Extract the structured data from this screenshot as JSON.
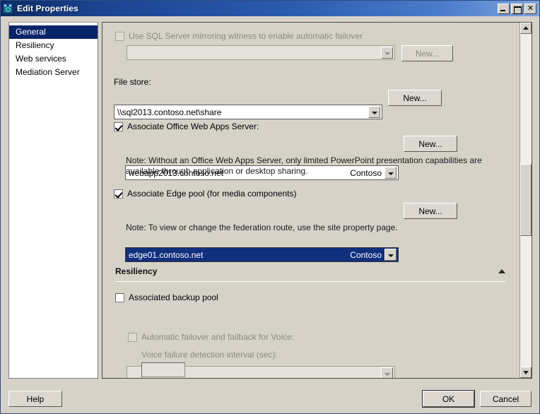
{
  "window": {
    "title": "Edit Properties",
    "icon": "server-properties-icon",
    "controls": {
      "minimize": "_",
      "maximize": "□",
      "close": "✕"
    }
  },
  "sidebar": {
    "items": [
      {
        "label": "General",
        "selected": true
      },
      {
        "label": "Resiliency",
        "selected": false
      },
      {
        "label": "Web services",
        "selected": false
      },
      {
        "label": "Mediation Server",
        "selected": false
      }
    ]
  },
  "main": {
    "sql_mirroring": {
      "checkbox_label": "Use SQL Server mirroring witness to enable automatic failover",
      "checked": false,
      "enabled": false,
      "combo_value": "",
      "new_button": "New..."
    },
    "file_store": {
      "label": "File store:",
      "combo_value": "\\\\sql2013.contoso.net\\share",
      "new_button": "New..."
    },
    "office_web_apps": {
      "checkbox_label": "Associate Office Web Apps Server:",
      "checked": true,
      "combo_value": "webapp2013.contoso.net",
      "combo_right_value": "Contoso",
      "new_button": "New...",
      "note": "Note: Without an Office Web Apps Server, only limited PowerPoint presentation capabilities are available through application or desktop sharing."
    },
    "edge_pool": {
      "checkbox_label": "Associate Edge pool (for media components)",
      "checked": true,
      "combo_value": "edge01.contoso.net",
      "combo_right_value": "Contoso",
      "focused": true,
      "new_button": "New...",
      "note": "Note: To view or change the federation route, use the site property page."
    },
    "resiliency_section": {
      "title": "Resiliency",
      "collapse_icon": "chevron-up-icon",
      "backup_pool": {
        "checkbox_label": "Associated backup pool",
        "checked": false,
        "combo_value": ""
      },
      "voice_failover": {
        "checkbox_label": "Automatic failover and failback for Voice:",
        "checked": false,
        "enabled": false,
        "interval_label": "Voice failure detection interval (sec):",
        "interval_value": ""
      }
    }
  },
  "scrollbar": {
    "up_arrow": "scroll-up-icon",
    "down_arrow": "scroll-down-icon"
  },
  "footer": {
    "help": "Help",
    "ok": "OK",
    "cancel": "Cancel"
  },
  "colors": {
    "title_start": "#0b2a64",
    "title_end": "#7fa5de",
    "selection": "#0a246a",
    "combo_focus": "#10307e",
    "face": "#d6d2c8"
  }
}
